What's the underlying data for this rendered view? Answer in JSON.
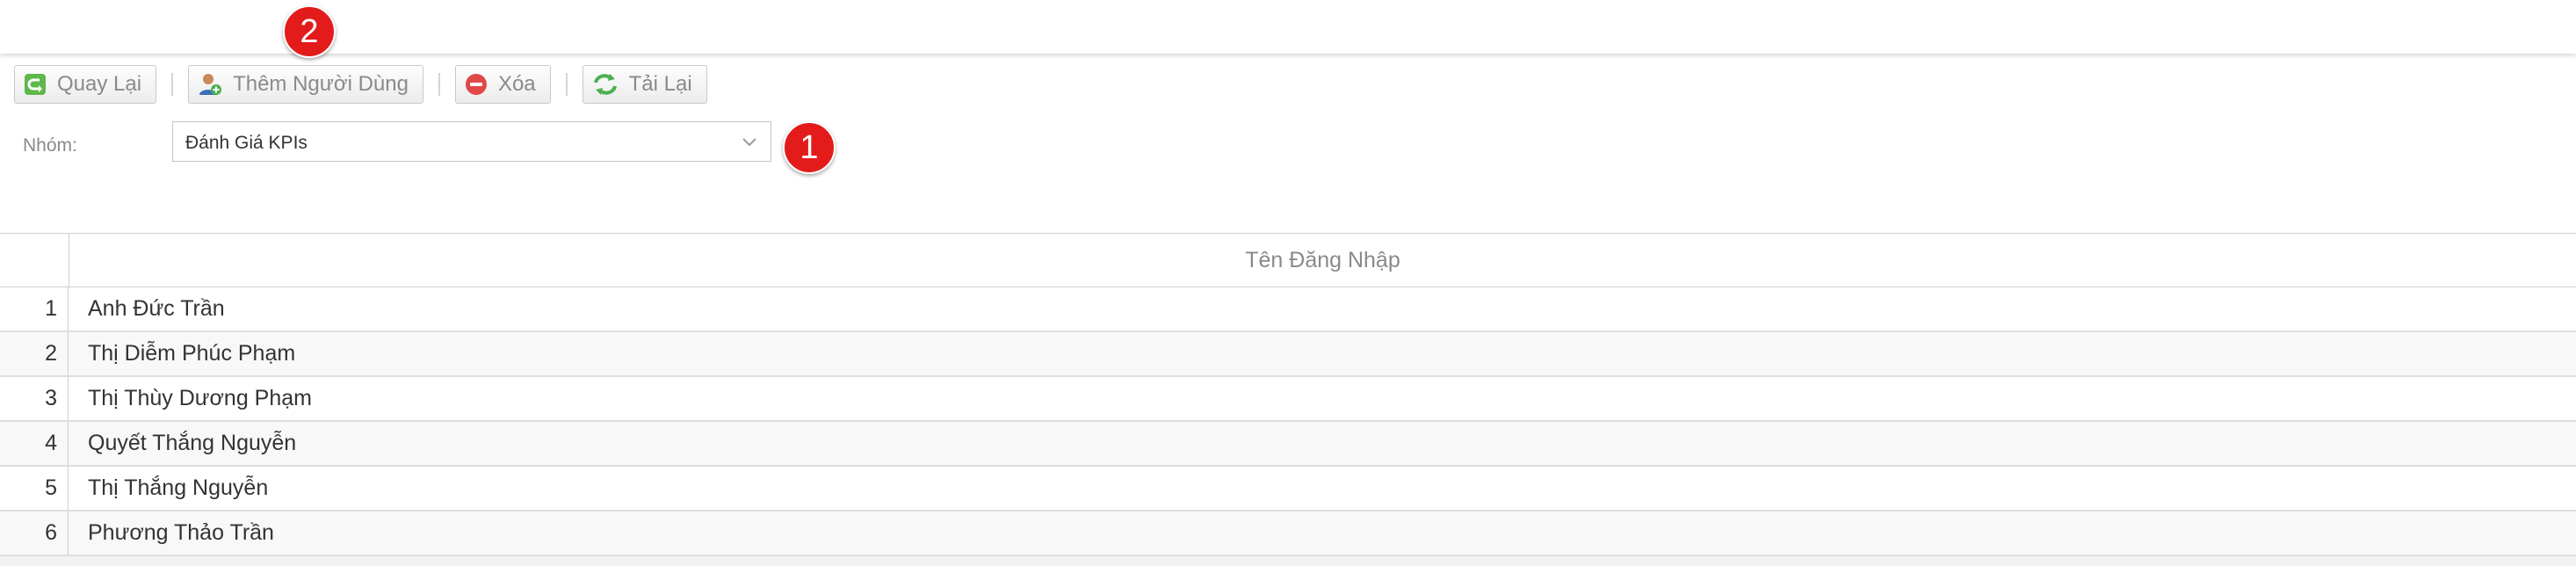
{
  "toolbar": {
    "back_label": "Quay Lại",
    "add_user_label": "Thêm Người Dùng",
    "delete_label": "Xóa",
    "reload_label": "Tải Lại"
  },
  "group": {
    "label": "Nhóm:",
    "selected": "Đánh Giá KPIs"
  },
  "markers": {
    "one": "1",
    "two": "2"
  },
  "table": {
    "column_header": "Tên Đăng Nhập",
    "rows": [
      {
        "index": "1",
        "username": "Anh Đức Trần"
      },
      {
        "index": "2",
        "username": "Thị Diễm Phúc Phạm"
      },
      {
        "index": "3",
        "username": "Thị Thùy Dương Phạm"
      },
      {
        "index": "4",
        "username": "Quyết Thắng Nguyễn"
      },
      {
        "index": "5",
        "username": "Thị Thắng Nguyễn"
      },
      {
        "index": "6",
        "username": "Phương Thảo Trần"
      }
    ]
  },
  "icons": {
    "back": "back-arrow-icon",
    "add_user": "add-user-icon",
    "delete": "delete-icon",
    "reload": "reload-icon",
    "dropdown": "chevron-down-icon"
  },
  "colors": {
    "marker": "#e41b1b",
    "back_icon": "#4caf50",
    "delete_icon": "#e04848"
  }
}
